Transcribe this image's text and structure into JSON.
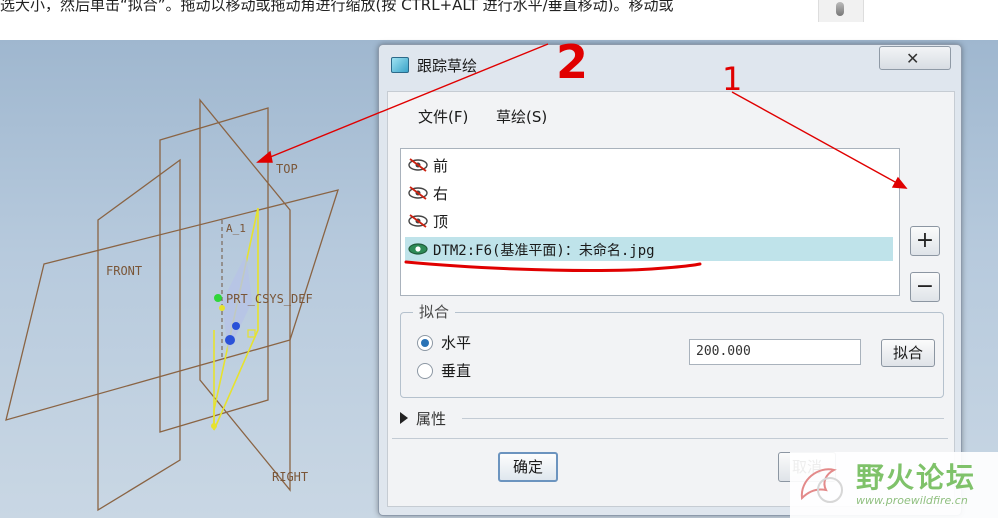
{
  "document": {
    "snippet": "选大小，然后单击“拟合”。拖动以移动或拖动角进行缩放(按 CTRL+ALT 进行水平/垂直移动)。移动或"
  },
  "viewport": {
    "planes": {
      "top": "TOP",
      "front": "FRONT",
      "right": "RIGHT",
      "csys": "PRT_CSYS_DEF",
      "axis": "A_1"
    }
  },
  "dialog": {
    "title": "跟踪草绘",
    "close_icon": "close-icon",
    "menu": {
      "file": "文件(F)",
      "sketch": "草绘(S)"
    },
    "layers": [
      {
        "label": "前",
        "visible": false,
        "selected": false
      },
      {
        "label": "右",
        "visible": false,
        "selected": false
      },
      {
        "label": "顶",
        "visible": false,
        "selected": false
      },
      {
        "label": "DTM2:F6(基准平面)：未命名.jpg",
        "visible": true,
        "selected": true
      }
    ],
    "add_label": "+",
    "remove_label": "−",
    "fit_group": {
      "legend": "拟合",
      "horizontal": "水平",
      "vertical": "垂直",
      "selected": "水平",
      "value": "200.000",
      "fit_button": "拟合"
    },
    "properties": "属性",
    "ok": "确定",
    "cancel": "取消"
  },
  "annotations": {
    "label_1": "1",
    "label_2": "2",
    "color": "#e00000"
  },
  "watermark": {
    "title": "野火论坛",
    "url": "www.proewildfire.cn",
    "color": "#7fc26a"
  }
}
